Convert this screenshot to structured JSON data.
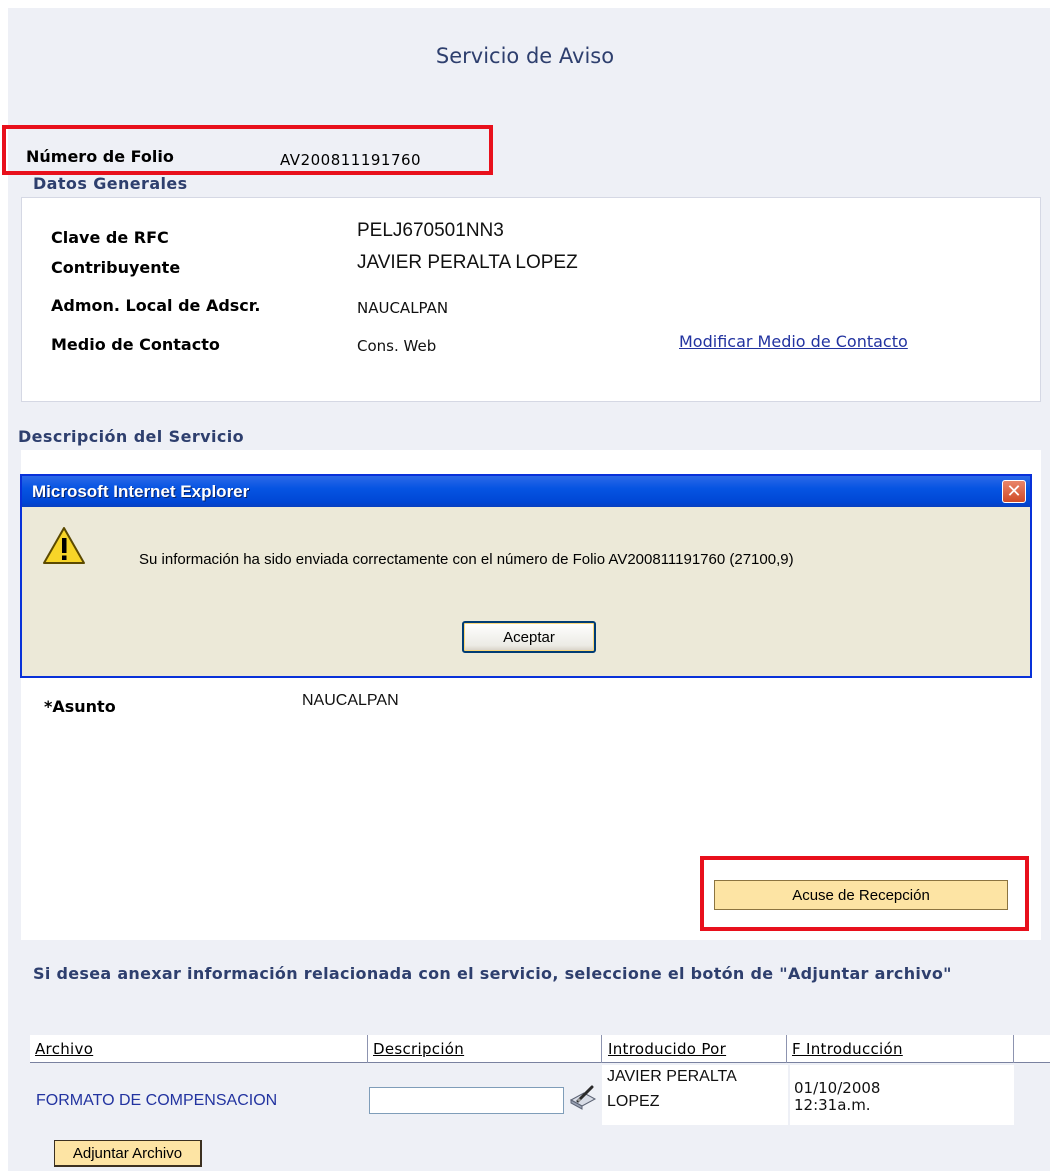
{
  "page": {
    "title": "Servicio de Aviso"
  },
  "folio": {
    "label": "Número de Folio",
    "value": "AV200811191760"
  },
  "datos_generales": {
    "title": "Datos Generales",
    "fields": [
      {
        "label": "Clave de RFC",
        "value": "PELJ670501NN3"
      },
      {
        "label": "Contribuyente",
        "value": "JAVIER PERALTA LOPEZ"
      },
      {
        "label": "Admon. Local de Adscr.",
        "value": "NAUCALPAN"
      },
      {
        "label": "Medio de Contacto",
        "value": "Cons. Web"
      }
    ],
    "modify_link": "Modificar Medio de Contacto"
  },
  "descripcion": {
    "title": "Descripción del Servicio",
    "asunto_label": "*Asunto",
    "asunto_value": "NAUCALPAN"
  },
  "dialog": {
    "title": "Microsoft Internet Explorer",
    "close_glyph": "✕",
    "icon": "warning-icon",
    "message": "Su información ha sido enviada correctamente con el número de Folio AV200811191760 (27100,9)",
    "button_label": "Aceptar"
  },
  "acuse_button": "Acuse de Recepción",
  "anexar": {
    "text": "Si desea anexar información relacionada con el servicio, seleccione el botón de \"Adjuntar archivo\""
  },
  "files_table": {
    "columns": [
      "Archivo",
      "Descripción",
      "Introducido Por",
      "F Introducción"
    ],
    "rows": [
      {
        "archivo": "FORMATO DE COMPENSACION",
        "descripcion": "",
        "introducido_por_line1": "JAVIER PERALTA",
        "introducido_por_line2": "LOPEZ",
        "fecha_line1": "01/10/2008",
        "fecha_line2": "12:31a.m."
      }
    ]
  },
  "adjuntar_button": "Adjuntar Archivo",
  "colors": {
    "highlight": "#e8101c",
    "heading": "#2e3f6e",
    "link": "#2233a0",
    "button_bg": "#fde4a4",
    "dialog_title_bg": "#0654e2"
  }
}
